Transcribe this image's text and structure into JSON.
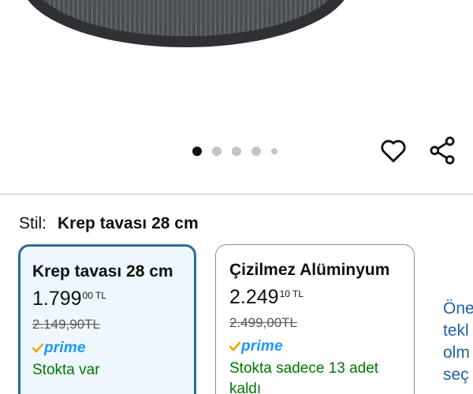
{
  "carousel": {
    "dot_count": 5,
    "active_index": 0
  },
  "icons": {
    "favorite": "heart-icon",
    "share": "share-icon",
    "prime_check": "checkmark-icon"
  },
  "style_selector": {
    "label": "Stil:",
    "selected": "Krep tavası 28 cm"
  },
  "options": [
    {
      "title": "Krep tavası 28 cm",
      "price_main": "1.799",
      "price_sup": "00 TL",
      "old_price": "2.149,90TL",
      "prime": "prime",
      "stock": "Stokta var",
      "selected": true
    },
    {
      "title": "Çizilmez Alüminyum",
      "price_main": "2.249",
      "price_sup": "10 TL",
      "old_price": "2.499,00TL",
      "prime": "prime",
      "stock": "Stokta sadece 13 adet kaldı",
      "selected": false
    }
  ],
  "side_text": [
    "Öne",
    "tekl",
    "olm",
    "seç"
  ],
  "colors": {
    "accent": "#2d6a96",
    "prime": "#1a98ff",
    "stock": "#007600",
    "link": "#2162a1"
  }
}
